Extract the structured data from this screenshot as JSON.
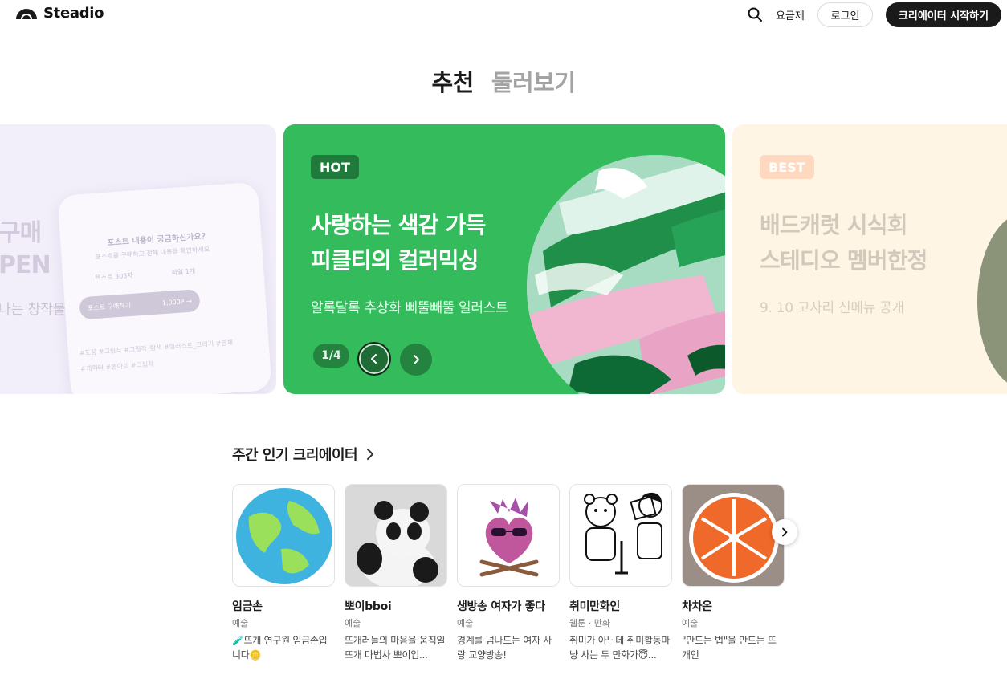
{
  "header": {
    "logo_text": "Steadio",
    "pricing_label": "요금제",
    "login_label": "로그인",
    "start_label": "크리에이터 시작하기"
  },
  "tabs": [
    {
      "label": "추천",
      "active": true
    },
    {
      "label": "둘러보기",
      "active": false
    }
  ],
  "banners": {
    "left": {
      "title_line1": "구매",
      "title_line2": "PEN",
      "subtitle": "나는 창작물",
      "phone_question": "포스트 내용이 궁금하신가요?",
      "phone_sub": "포스트를 구매하고 전체 내용을 확인하세요",
      "phone_text_count": "텍스트 305자",
      "phone_file_count": "파일 1개",
      "phone_buy_label": "포스트 구매하기",
      "phone_price": "1,000P →",
      "phone_tags": "#도움  #그림작  #그림작_탐색  #일러스트_그리기  #연재  #캐릭터  #팬아트  #그림작"
    },
    "center": {
      "badge": "HOT",
      "title_line1": "사랑하는 색감 가득",
      "title_line2": "피클티의 컬러믹싱",
      "subtitle": "알록달록 추상화 삐뚤빼뚤 일러스트",
      "pager": "1/4",
      "color": "#33bb5c"
    },
    "right": {
      "badge": "BEST",
      "title_line1": "배드캐럿 시식회",
      "title_line2": "스테디오 멤버한정",
      "subtitle": "9. 10 고사리 신메뉴 공개"
    }
  },
  "section": {
    "title": "주간 인기 크리에이터"
  },
  "creators": [
    {
      "name": "임금손",
      "category": "예술",
      "desc": "🧪뜨개 연구원 임금손입니다🪙",
      "thumb": "globe-knit"
    },
    {
      "name": "뽀이bboi",
      "category": "예술",
      "desc": "뜨개러들의 마음을 움직일 뜨개 마법사 뽀이입...",
      "thumb": "panda-knit"
    },
    {
      "name": "생방송 여자가 좋다",
      "category": "예술",
      "desc": "경계를 넘나드는 여자 사랑 교양방송!",
      "thumb": "heart-sunglasses"
    },
    {
      "name": "취미만화인",
      "category": "웹툰 · 만화",
      "desc": "취미가 아닌데 취미활동마냥 사는 두 만화가😇...",
      "thumb": "comic-sketch"
    },
    {
      "name": "차차온",
      "category": "예술",
      "desc": "\"만드는 법\"을 만드는 뜨개인",
      "thumb": "orange-coaster"
    }
  ]
}
